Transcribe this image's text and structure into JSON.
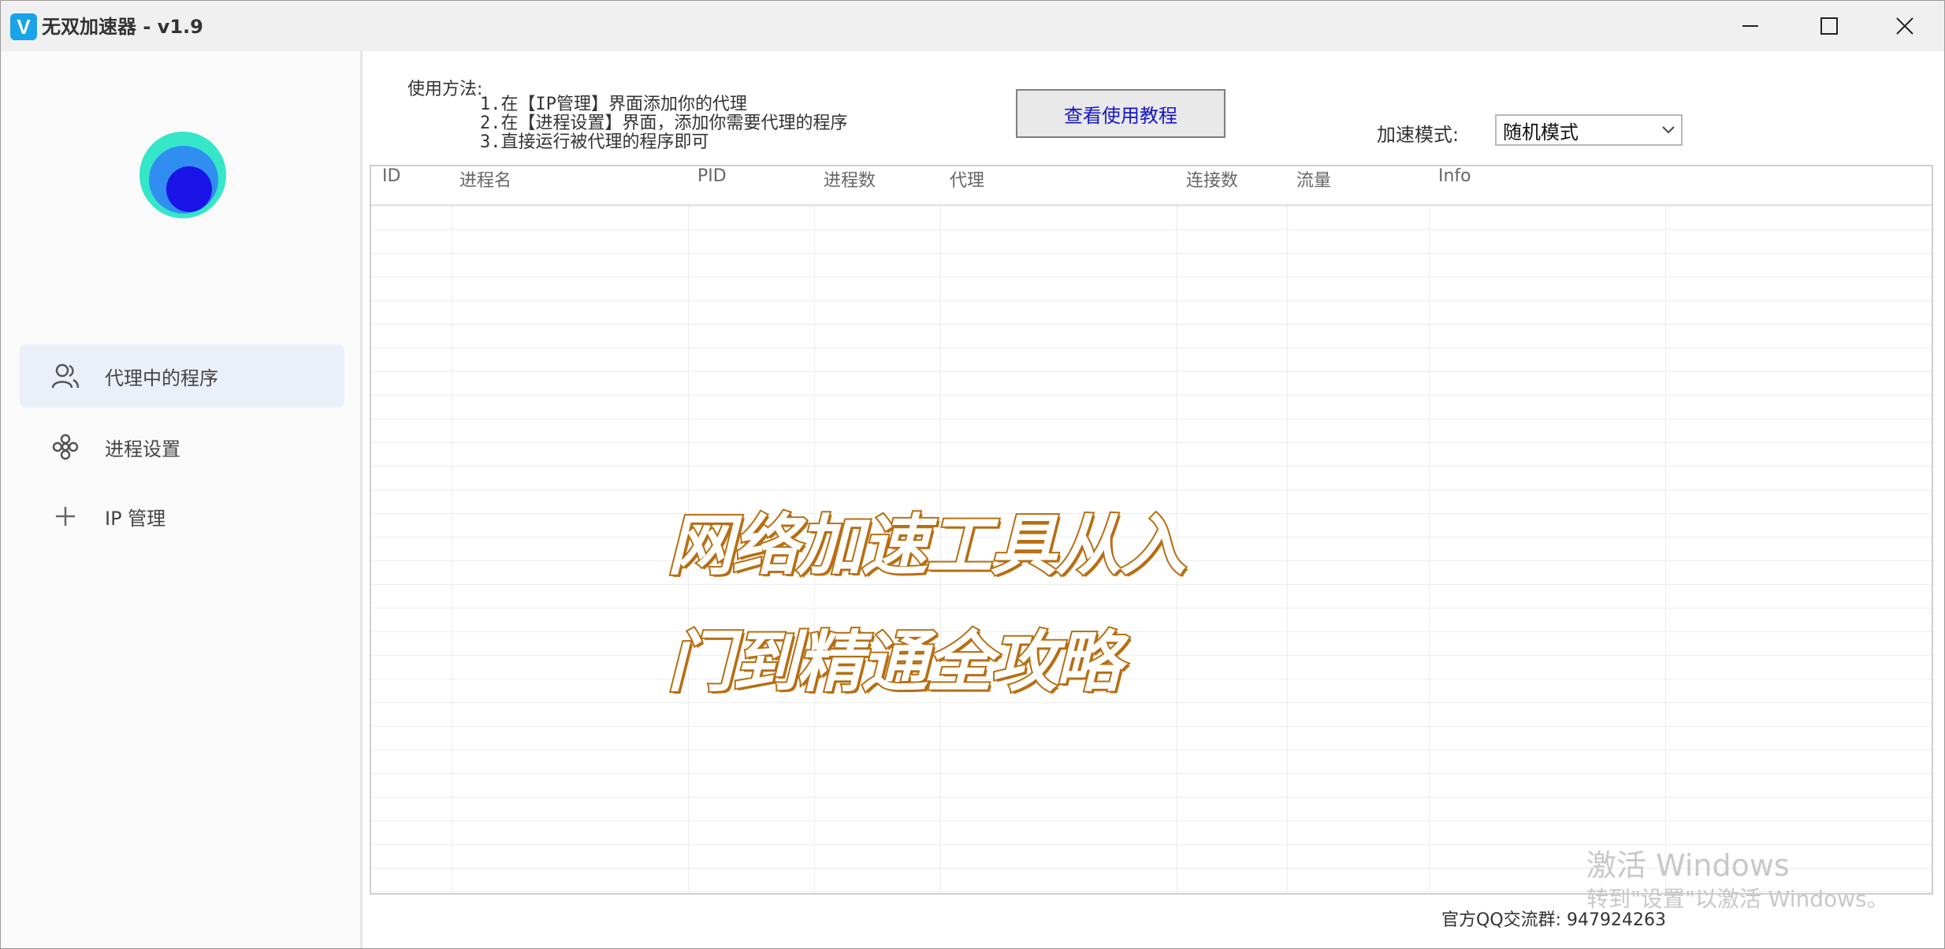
{
  "window": {
    "title": "无双加速器 - v1.9",
    "icon_letter": "V"
  },
  "sidebar": {
    "items": [
      {
        "label": "代理中的程序",
        "icon": "user-group-icon",
        "active": true
      },
      {
        "label": "进程设置",
        "icon": "process-settings-icon",
        "active": false
      },
      {
        "label": "IP 管理",
        "icon": "plus-icon",
        "active": false
      }
    ]
  },
  "usage": {
    "heading": "使用方法:",
    "steps": [
      "1.在【IP管理】界面添加你的代理",
      "2.在【进程设置】界面，添加你需要代理的程序",
      "3.直接运行被代理的程序即可"
    ]
  },
  "toolbar": {
    "tutorial_button": "查看使用教程",
    "mode_label": "加速模式:",
    "mode_value": "随机模式"
  },
  "table": {
    "columns": [
      "ID",
      "进程名",
      "PID",
      "进程数",
      "代理",
      "连接数",
      "流量",
      "Info"
    ],
    "rows": []
  },
  "overlay": {
    "line1": "网络加速工具从入",
    "line2": "门到精通全攻略"
  },
  "footer": {
    "qq_group": "官方QQ交流群: 947924263"
  },
  "watermark": {
    "title": "激活 Windows",
    "subtitle": "转到\"设置\"以激活 Windows。"
  },
  "colors": {
    "link_blue": "#1515c8",
    "overlay_stroke": "#b86e10",
    "sidebar_active": "#ebeff7"
  }
}
